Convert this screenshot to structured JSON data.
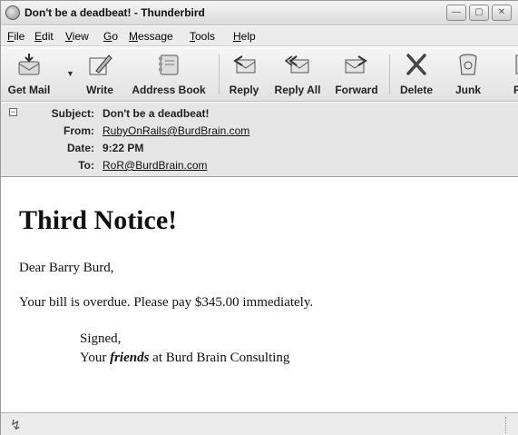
{
  "window": {
    "title": "Don't be a deadbeat! - Thunderbird",
    "controls": {
      "minimize": "—",
      "maximize": "▢",
      "close": "✕"
    }
  },
  "menu": {
    "items": [
      {
        "key": "F",
        "rest": "ile"
      },
      {
        "key": "E",
        "rest": "dit"
      },
      {
        "key": "V",
        "rest": "iew"
      },
      {
        "key": "G",
        "rest": "o"
      },
      {
        "key": "M",
        "rest": "essage"
      },
      {
        "key": "T",
        "rest": "ools"
      },
      {
        "key": "H",
        "rest": "elp"
      }
    ]
  },
  "toolbar": {
    "buttons": [
      {
        "label": "Get Mail",
        "icon": "get-mail-icon"
      },
      {
        "label": "Write",
        "icon": "write-icon"
      },
      {
        "label": "Address Book",
        "icon": "address-book-icon"
      },
      {
        "label": "Reply",
        "icon": "reply-icon"
      },
      {
        "label": "Reply All",
        "icon": "reply-all-icon"
      },
      {
        "label": "Forward",
        "icon": "forward-icon"
      },
      {
        "label": "Delete",
        "icon": "delete-icon"
      },
      {
        "label": "Junk",
        "icon": "junk-icon"
      },
      {
        "label": "P",
        "icon": "print-icon"
      }
    ],
    "get_mail_caret": "▼"
  },
  "headers": {
    "collapse_glyph": "−",
    "subject_label": "Subject:",
    "subject": "Don't be a deadbeat!",
    "from_label": "From:",
    "from": "RubyOnRails@BurdBrain.com",
    "date_label": "Date:",
    "date": "9:22 PM",
    "to_label": "To:",
    "to": "RoR@BurdBrain.com"
  },
  "message": {
    "heading": "Third Notice!",
    "greeting": "Dear Barry Burd,",
    "body": "Your bill is overdue. Please pay $345.00 immediately.",
    "signed": "Signed,",
    "sig_prefix": "Your",
    "sig_emphasis": "friends",
    "sig_suffix": "at Burd Brain Consulting"
  },
  "status": {
    "icon": "online-status-icon",
    "glyph": "↯"
  }
}
